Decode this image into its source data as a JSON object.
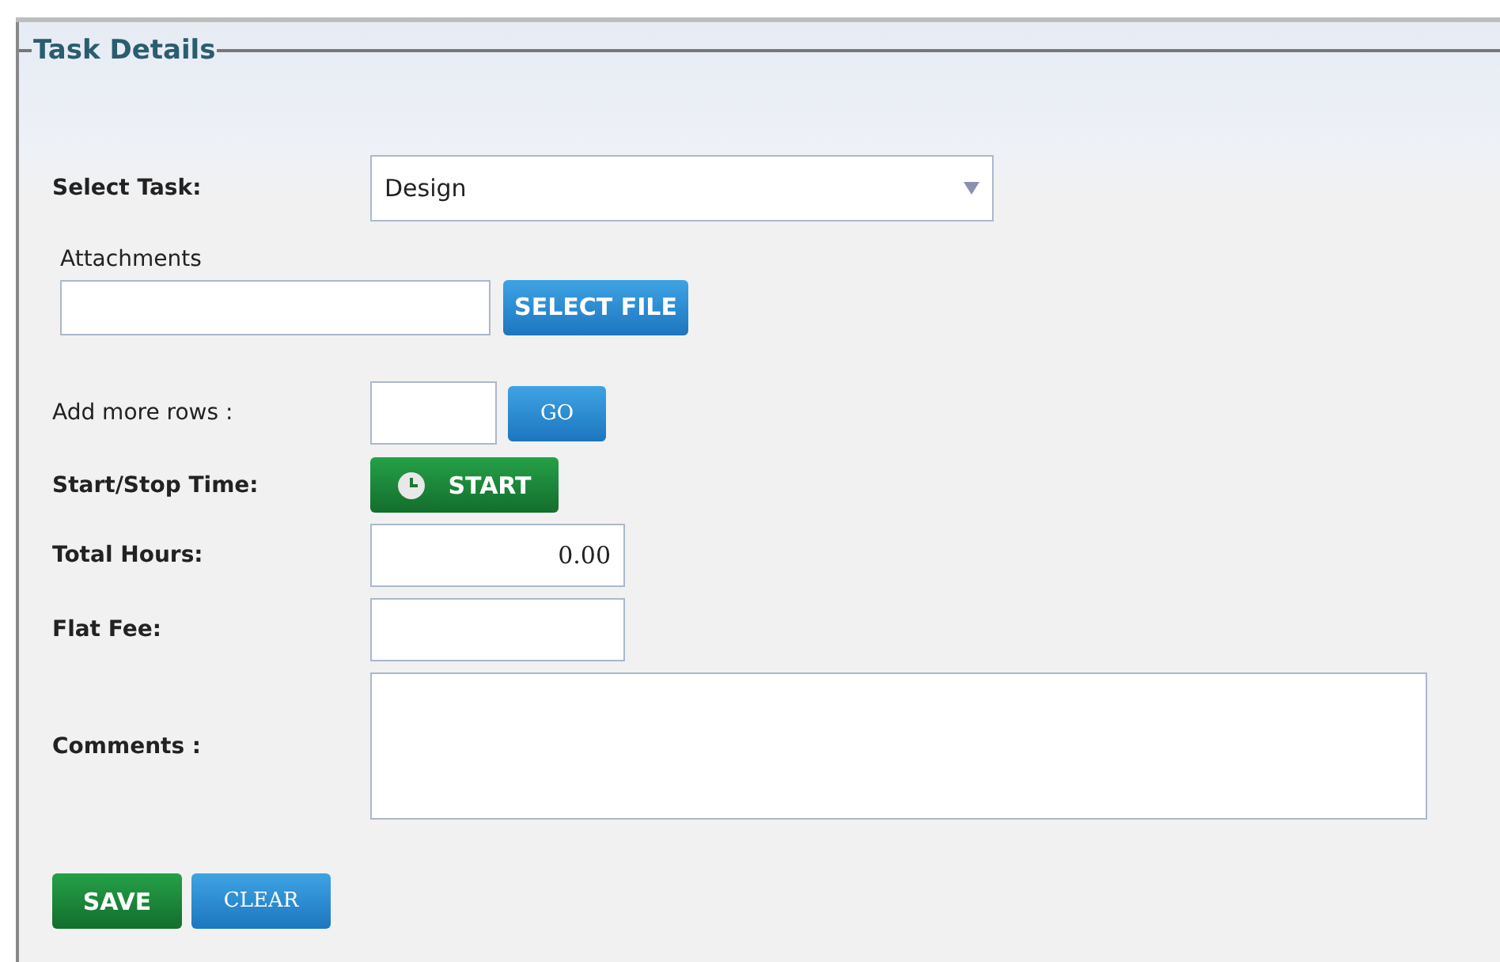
{
  "panel": {
    "title": "Task Details"
  },
  "fields": [
    {
      "kind": "select",
      "label": "Select Task:",
      "value": "Design"
    },
    {
      "kind": "file",
      "label": "Attachments",
      "button": "SELECT FILE"
    },
    {
      "kind": "number-go",
      "label": "Add more rows :",
      "button": "GO"
    },
    {
      "kind": "timer",
      "label": "Start/Stop Time:",
      "button": "START"
    },
    {
      "kind": "text",
      "label": "Total Hours:",
      "value": "0.00"
    },
    {
      "kind": "text",
      "label": "Flat Fee:"
    },
    {
      "kind": "textarea",
      "label": "Comments :"
    }
  ],
  "actions": [
    {
      "label": "SAVE",
      "kind": "primary"
    },
    {
      "label": "CLEAR",
      "kind": "secondary"
    }
  ]
}
